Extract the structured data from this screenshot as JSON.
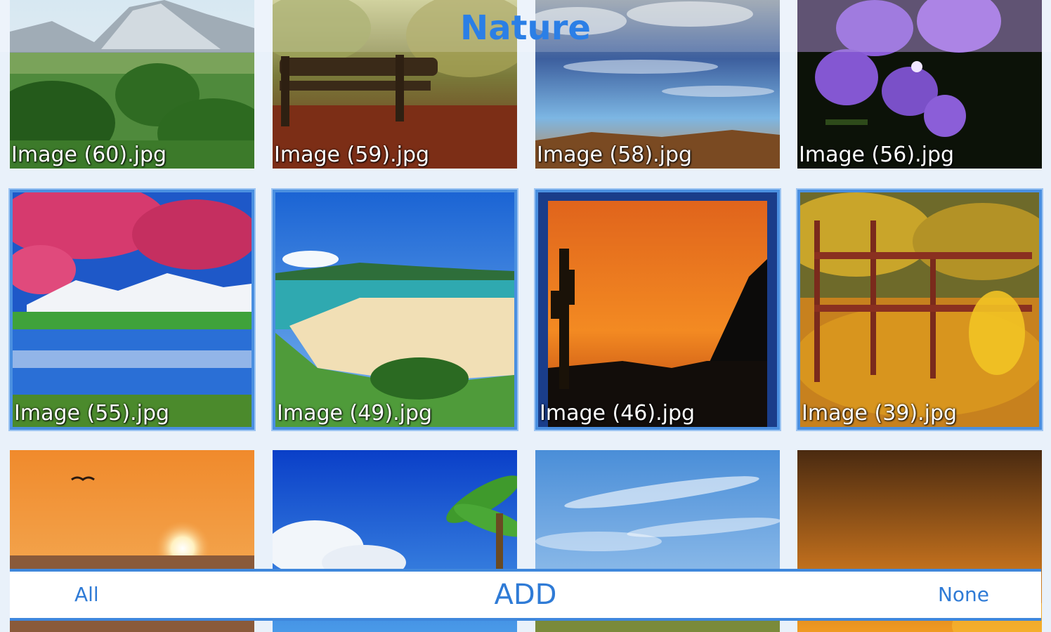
{
  "header": {
    "title": "Nature"
  },
  "images": [
    {
      "name": "Image (60).jpg",
      "selected": false,
      "scene": "mountain-valley"
    },
    {
      "name": "Image (59).jpg",
      "selected": false,
      "scene": "park-bench-autumn"
    },
    {
      "name": "Image (58).jpg",
      "selected": false,
      "scene": "cloudy-sky-desert"
    },
    {
      "name": "Image (56).jpg",
      "selected": false,
      "scene": "purple-orchid"
    },
    {
      "name": "Image (55).jpg",
      "selected": true,
      "scene": "cherry-blossom-lake"
    },
    {
      "name": "Image (49).jpg",
      "selected": true,
      "scene": "tropical-beach"
    },
    {
      "name": "Image (46).jpg",
      "selected": true,
      "scene": "desert-sunset-cactus"
    },
    {
      "name": "Image (39).jpg",
      "selected": true,
      "scene": "autumn-fence"
    },
    {
      "name": "",
      "selected": false,
      "scene": "ocean-sunset-bird"
    },
    {
      "name": "",
      "selected": false,
      "scene": "palm-blue-sky"
    },
    {
      "name": "",
      "selected": false,
      "scene": "wispy-clouds"
    },
    {
      "name": "",
      "selected": false,
      "scene": "amber-gradient"
    }
  ],
  "actions": {
    "all_label": "All",
    "add_label": "ADD",
    "none_label": "None"
  },
  "colors": {
    "accent": "#2b7fe6",
    "selection_border": "#4a8fe0",
    "background": "#e9f1fa"
  }
}
